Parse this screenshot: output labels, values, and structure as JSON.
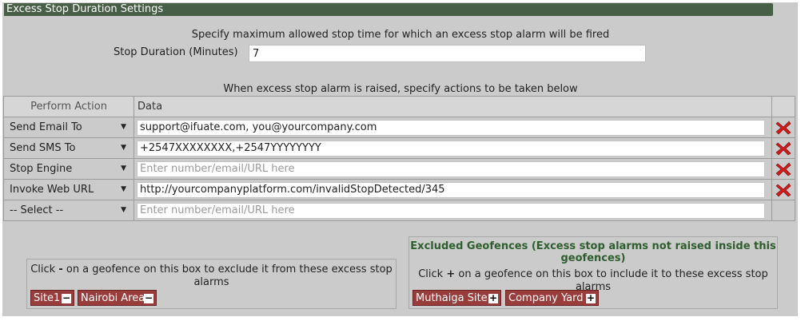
{
  "title": "Excess Stop Duration Settings",
  "duration": {
    "instruction": "Specify maximum allowed stop time for which an excess stop alarm will be fired",
    "label": "Stop Duration (Minutes)",
    "value": "7"
  },
  "actions_instruction": "When excess stop alarm is raised, specify actions to be taken below",
  "table": {
    "headers": [
      "Perform Action",
      "Data",
      ""
    ],
    "rows": [
      {
        "action": "Send Email To",
        "data": "support@ifuate.com, you@yourcompany.com",
        "placeholder": "",
        "delete": true
      },
      {
        "action": "Send SMS To",
        "data": "+2547XXXXXXXX,+2547YYYYYYYY",
        "placeholder": "",
        "delete": true
      },
      {
        "action": "Stop Engine",
        "data": "",
        "placeholder": "Enter number/email/URL here",
        "delete": true
      },
      {
        "action": "Invoke Web URL",
        "data": "http://yourcompanyplatform.com/invalidStopDetected/345",
        "placeholder": "",
        "delete": true
      },
      {
        "action": "-- Select --",
        "data": "",
        "placeholder": "Enter number/email/URL here",
        "delete": false
      }
    ]
  },
  "included": {
    "help_prefix": "Click",
    "help_symbol": "-",
    "help_suffix": "on a geofence on this box to exclude it from these excess stop alarms",
    "chips": [
      {
        "label": "Site1",
        "symbol": "−"
      },
      {
        "label": "Nairobi Area",
        "symbol": "−"
      }
    ]
  },
  "excluded": {
    "title": "Excluded Geofences (Excess stop alarms not raised inside this geofences)",
    "help_prefix": "Click",
    "help_symbol": "+",
    "help_suffix": "on a geofence on this box to include it to these excess stop alarms",
    "chips": [
      {
        "label": "Muthaiga Site",
        "symbol": "+"
      },
      {
        "label": "Company Yard",
        "symbol": "+"
      }
    ]
  },
  "colors": {
    "title_bar": "#465f46",
    "chip": "#993c3c",
    "excluded_title": "#2e5e2e",
    "delete_icon": "#d11a1a"
  }
}
